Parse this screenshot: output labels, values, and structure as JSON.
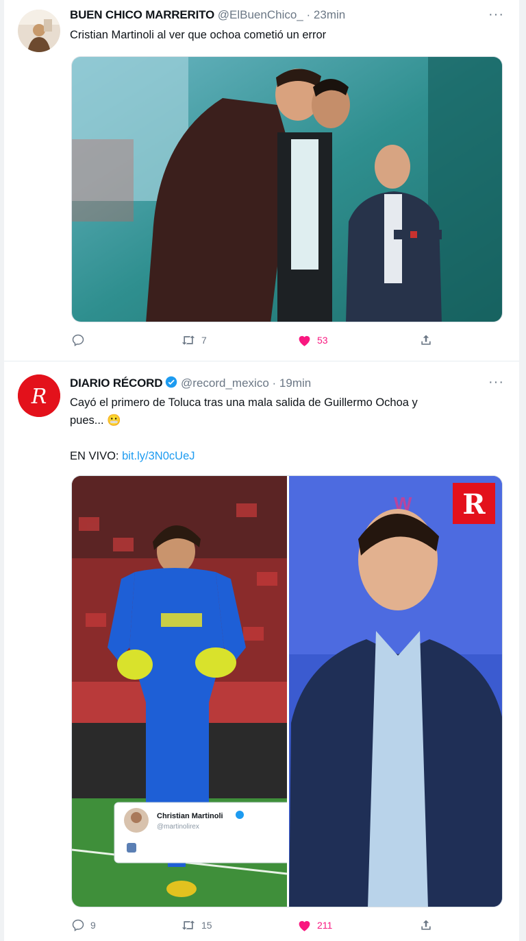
{
  "tweets": [
    {
      "name": "BUEN CHICO MARRERITO",
      "handle": "@ElBuenChico_",
      "sep": "·",
      "time": "23min",
      "more": "···",
      "text": "Cristian Martinoli al ver que ochoa cometió un error",
      "replies": "",
      "retweets": "7",
      "likes": "53",
      "icons": [
        "reply-icon",
        "retweet-icon",
        "heart-icon",
        "share-icon"
      ]
    },
    {
      "name": "DIARIO RÉCORD",
      "handle": "@record_mexico",
      "sep": "·",
      "time": "19min",
      "more": "···",
      "text_line1": "Cayó el primero de Toluca tras una mala salida de Guillermo Ochoa y",
      "text_line2": "pues...",
      "emoji": "😬",
      "live_label": "EN VIVO:",
      "link": "bit.ly/3N0cUeJ",
      "replies": "9",
      "retweets": "15",
      "likes": "211",
      "avatar_monogram": "R",
      "media_logo": "R",
      "embedded": {
        "name": "Christian Martinoli",
        "handle": "@martinolirex"
      }
    }
  ],
  "colors": {
    "like": "#f91880",
    "link": "#1d9bf0",
    "verified": "#1d9bf0",
    "record_red": "#e3111b"
  }
}
